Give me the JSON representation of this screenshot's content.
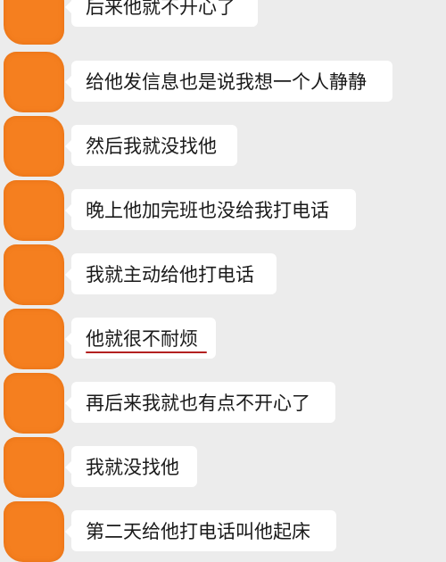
{
  "messages": [
    {
      "text": "后来他就不开心了"
    },
    {
      "text": "给他发信息也是说我想一个人静静"
    },
    {
      "text": "然后我就没找他"
    },
    {
      "text": "晚上他加完班也没给我打电话"
    },
    {
      "text": "我就主动给他打电话"
    },
    {
      "text": "他就很不耐烦",
      "underline": true
    },
    {
      "text": "再后来我就也有点不开心了"
    },
    {
      "text": "我就没找他"
    },
    {
      "text": "第二天给他打电话叫他起床"
    }
  ],
  "colors": {
    "background": "#ececec",
    "bubble": "#ffffff",
    "avatar_mask": "#f57f1f",
    "underline": "#b3201f"
  }
}
